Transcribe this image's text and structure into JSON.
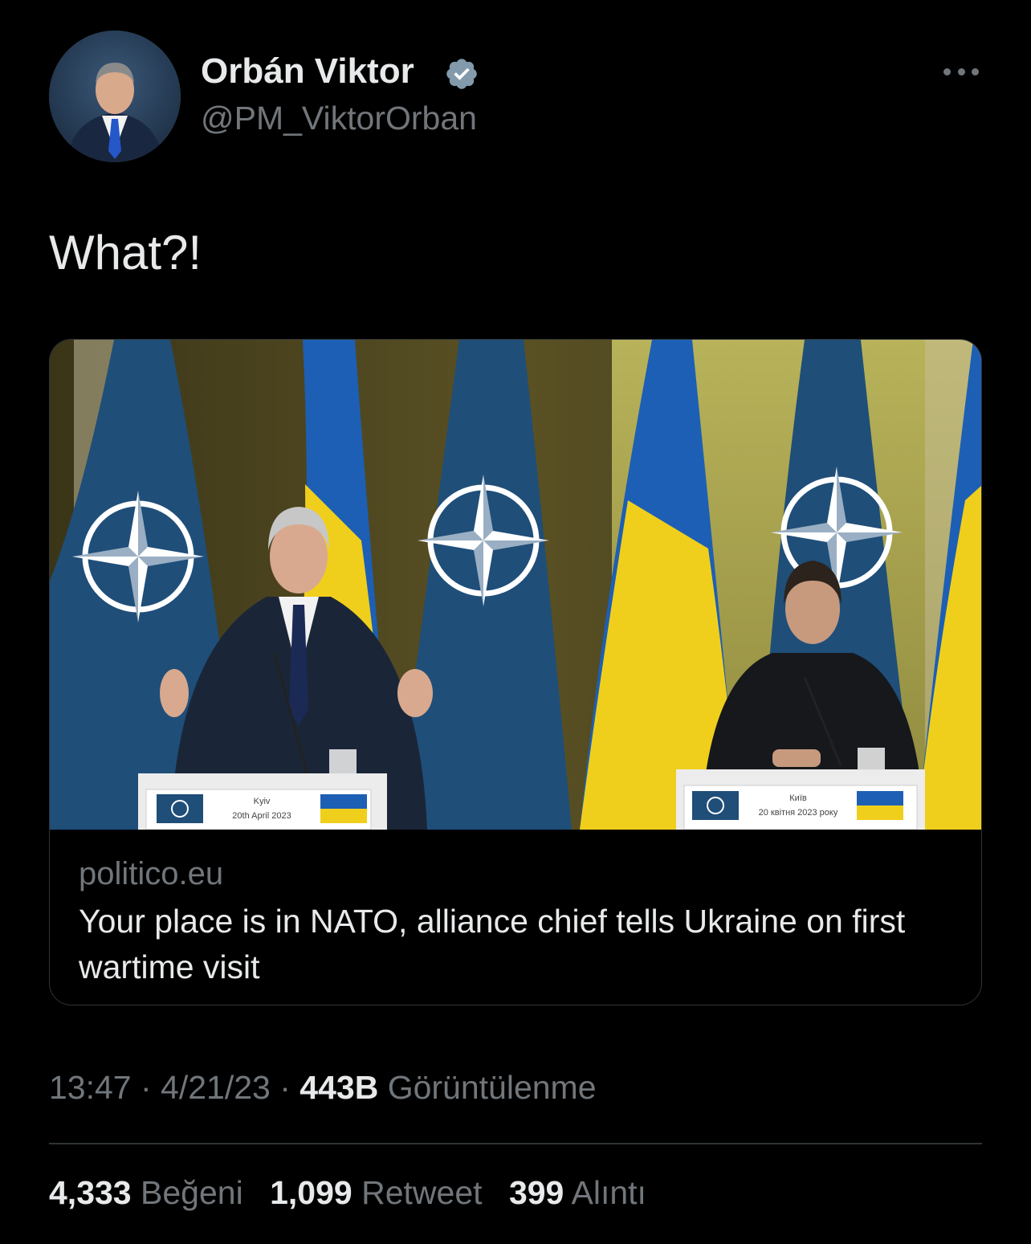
{
  "author": {
    "display_name": "Orbán Viktor",
    "handle": "@PM_ViktorOrban",
    "verified": true
  },
  "tweet": {
    "text": "What?!"
  },
  "link_card": {
    "domain": "politico.eu",
    "title": "Your place is in NATO, alliance chief tells Ukraine on first wartime visit",
    "image": {
      "left_podium_city": "Kyiv",
      "left_podium_date": "20th April 2023",
      "right_podium_city": "Київ",
      "right_podium_date": "20 квітня 2023 року"
    }
  },
  "meta": {
    "time": "13:47",
    "separator": " · ",
    "date": "4/21/23",
    "views_count": "443B",
    "views_label": "Görüntülenme"
  },
  "stats": {
    "likes_count": "4,333",
    "likes_label": "Beğeni",
    "retweets_count": "1,099",
    "retweets_label": "Retweet",
    "quotes_count": "399",
    "quotes_label": "Alıntı"
  },
  "colors": {
    "background": "#000000",
    "primary_text": "#e7e9ea",
    "secondary_text": "#71767b",
    "border": "#2f3336",
    "verified": "#829aab",
    "nato_blue": "#1f4e79",
    "ukraine_blue": "#1d5fb4",
    "ukraine_yellow": "#f0cf1c"
  }
}
